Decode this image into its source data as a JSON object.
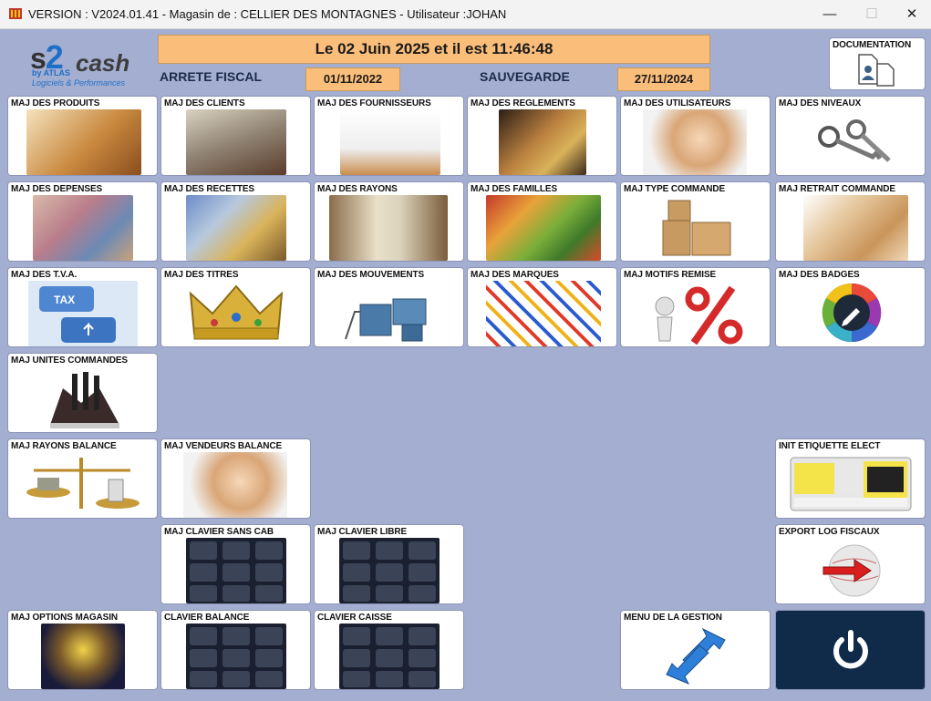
{
  "window": {
    "title": "VERSION  : V2024.01.41 - Magasin de : CELLIER DES MONTAGNES - Utilisateur :JOHAN",
    "minimize": "—",
    "maximize": "☐",
    "close": "✕"
  },
  "logo": {
    "s": "s",
    "two": "2",
    "cash": "cash",
    "by": "by ATLAS",
    "tagline": "Logiciels & Performances"
  },
  "header": {
    "datetime": "Le 02 Juin 2025 et il est 11:46:48",
    "arrete_label": "ARRETE FISCAL",
    "arrete_date": "01/11/2022",
    "sauvegarde_label": "SAUVEGARDE",
    "sauvegarde_date": "27/11/2024",
    "documentation": "DOCUMENTATION"
  },
  "tiles": {
    "produits": "MAJ DES PRODUITS",
    "clients": "MAJ DES CLIENTS",
    "fournisseurs": "MAJ DES FOURNISSEURS",
    "reglements": "MAJ DES REGLEMENTS",
    "utilisateurs": "MAJ DES UTILISATEURS",
    "niveaux": "MAJ DES NIVEAUX",
    "depenses": "MAJ DES DEPENSES",
    "recettes": "MAJ DES RECETTES",
    "rayons": "MAJ DES RAYONS",
    "familles": "MAJ DES FAMILLES",
    "type_commande": "MAJ TYPE COMMANDE",
    "retrait_commande": "MAJ RETRAIT COMMANDE",
    "tva": "MAJ DES T.V.A.",
    "titres": "MAJ DES TITRES",
    "mouvements": "MAJ DES MOUVEMENTS",
    "marques": "MAJ DES MARQUES",
    "motifs_remise": "MAJ MOTIFS REMISE",
    "badges": "MAJ DES BADGES",
    "unites_commandes": "MAJ UNITES COMMANDES",
    "rayons_balance": "MAJ RAYONS BALANCE",
    "vendeurs_balance": "MAJ VENDEURS BALANCE",
    "init_etiquette": "INIT ETIQUETTE ELECT",
    "clavier_sans_cab": "MAJ CLAVIER SANS CAB",
    "clavier_libre": "MAJ CLAVIER LIBRE",
    "export_log": "EXPORT LOG FISCAUX",
    "options_magasin": "MAJ OPTIONS MAGASIN",
    "clavier_balance": "CLAVIER BALANCE",
    "clavier_caisse": "CLAVIER CAISSE",
    "menu_gestion": "MENU DE LA GESTION"
  },
  "icons": {
    "app": "app-icon",
    "power": "power-icon",
    "documentation": "document-users-icon"
  },
  "colors": {
    "background": "#a3aed1",
    "header_fill": "#fbbe7a",
    "power_tile": "#0f2b49"
  }
}
